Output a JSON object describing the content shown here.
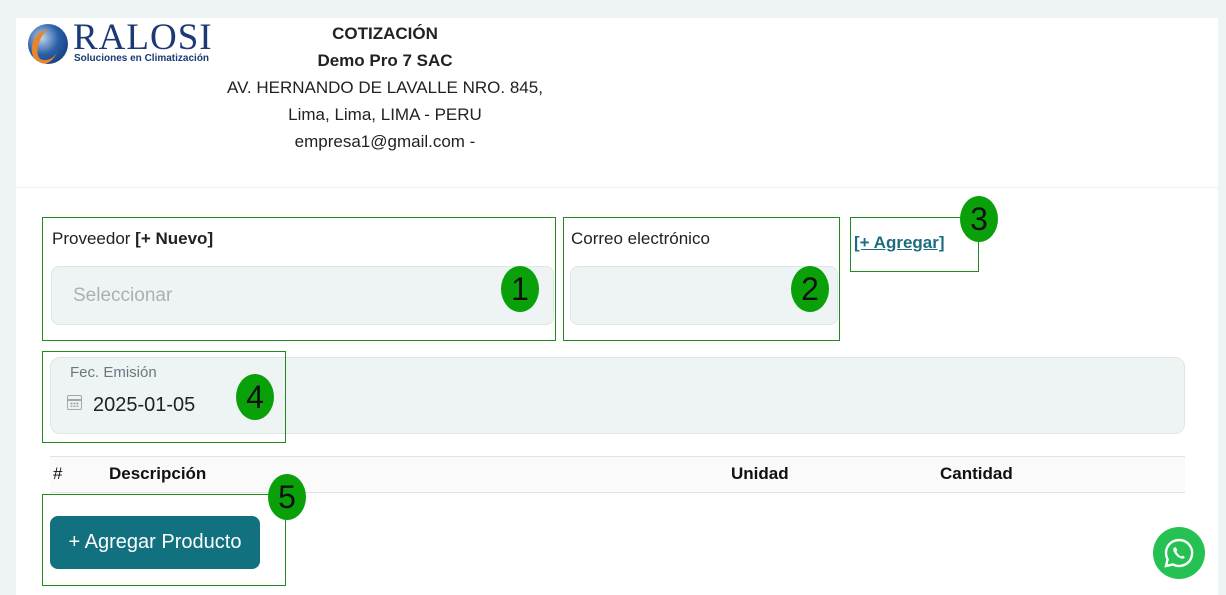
{
  "logo": {
    "name": "RALOSI",
    "tagline": "Soluciones en Climatización"
  },
  "company": {
    "doc_title": "COTIZACIÓN",
    "name": "Demo Pro 7 SAC",
    "address": "AV. HERNANDO DE LAVALLE NRO. 845,",
    "city": "Lima, Lima, LIMA - PERU",
    "contact": "empresa1@gmail.com -"
  },
  "form": {
    "provider_label": "Proveedor",
    "provider_new": "[+ Nuevo]",
    "provider_placeholder": "Seleccionar",
    "email_label": "Correo electrónico",
    "email_value": "",
    "add_link": "[+ Agregar]",
    "date_label": "Fec. Emisión",
    "date_value": "2025-01-05"
  },
  "badges": [
    "1",
    "2",
    "3",
    "4",
    "5"
  ],
  "table": {
    "headers": [
      "#",
      "Descripción",
      "Unidad",
      "Cantidad"
    ]
  },
  "add_product_button": "+ Agregar Producto",
  "colors": {
    "accent": "#11717f",
    "highlight_border": "#1f8b1f",
    "badge": "#0aa00a",
    "whatsapp": "#25c152"
  }
}
